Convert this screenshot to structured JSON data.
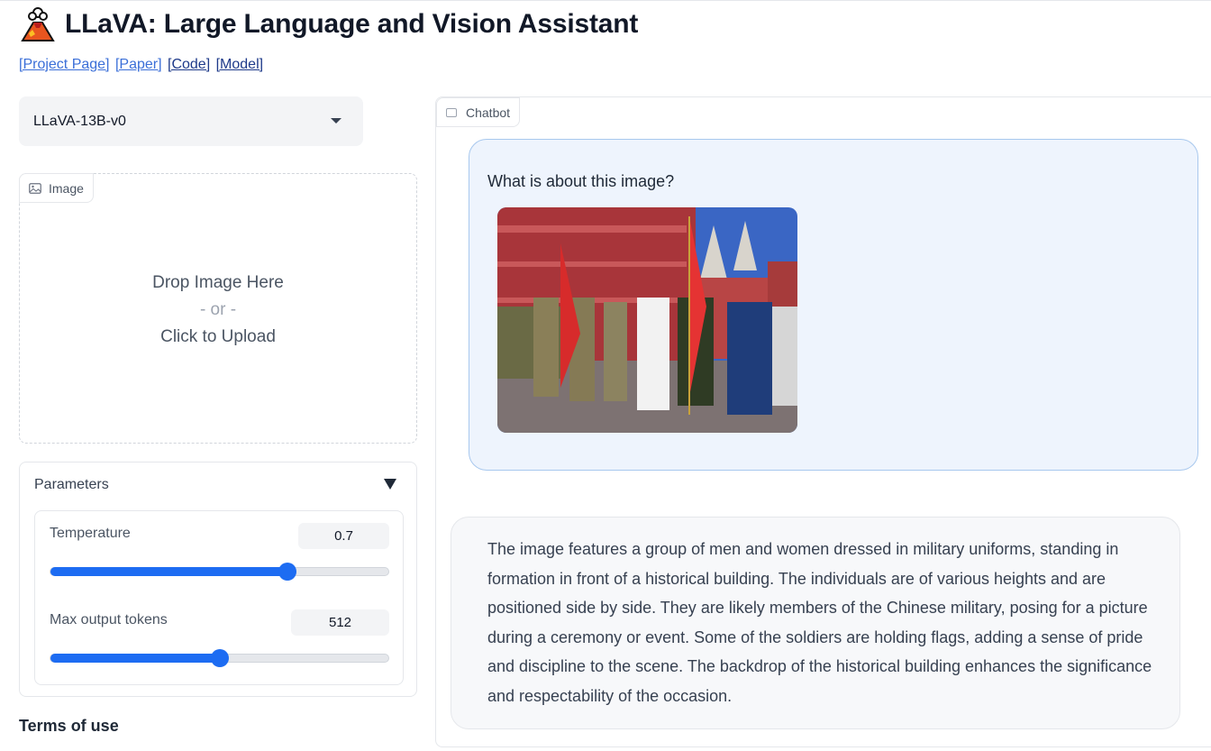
{
  "header": {
    "title": "LLaVA: Large Language and Vision Assistant",
    "logo_icon": "volcano-icon",
    "links": [
      {
        "label": "[Project Page]"
      },
      {
        "label": "[Paper]"
      },
      {
        "label": "[Code]"
      },
      {
        "label": "[Model]"
      }
    ]
  },
  "model_selector": {
    "value": "LLaVA-13B-v0"
  },
  "image_upload": {
    "tab_label": "Image",
    "drop_text": "Drop Image Here",
    "or_text": "- or -",
    "click_text": "Click to Upload"
  },
  "parameters": {
    "title": "Parameters",
    "temperature": {
      "label": "Temperature",
      "value": "0.7",
      "fraction": 0.7
    },
    "max_tokens": {
      "label": "Max output tokens",
      "value": "512",
      "fraction": 0.5
    }
  },
  "terms": {
    "label": "Terms of use"
  },
  "chatbot": {
    "tab_label": "Chatbot",
    "user_message": "What is about this image?",
    "bot_message": "The image features a group of men and women dressed in military uniforms, standing in formation in front of a historical building. The individuals are of various heights and are positioned side by side. They are likely members of the Chinese military, posing for a picture during a ceremony or event. Some of the soldiers are holding flags, adding a sense of pride and discipline to the scene. The backdrop of the historical building enhances the significance and respectability of the occasion."
  },
  "colors": {
    "accent": "#1d6cf2",
    "user_bubble": "#eef4fd",
    "link": "#3b6fd8"
  }
}
